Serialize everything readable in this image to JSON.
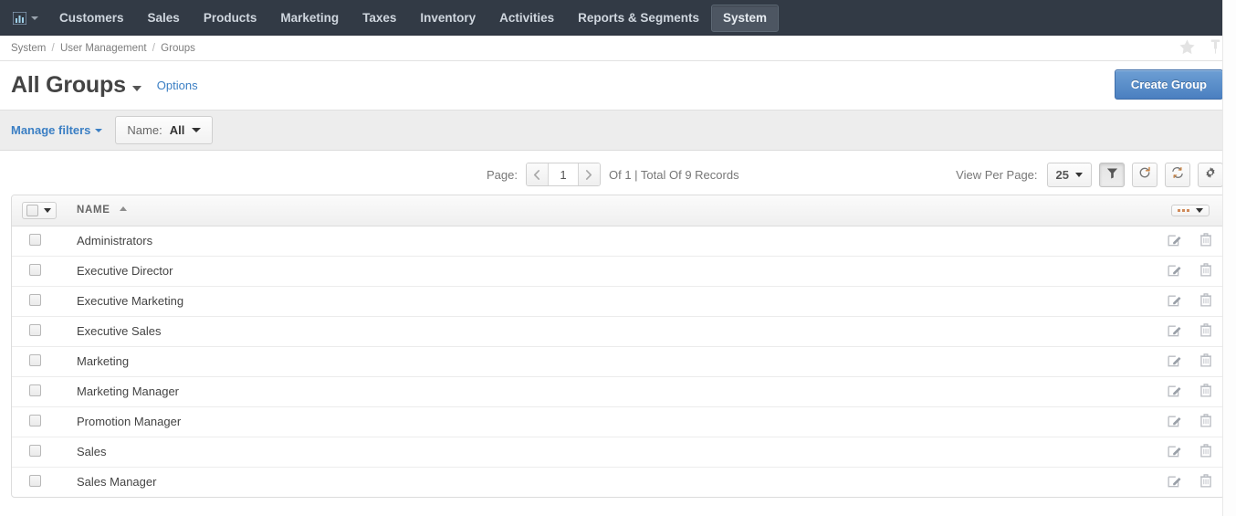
{
  "topnav": {
    "logo_icon": "bar-chart-icon",
    "items": [
      {
        "label": "Customers",
        "active": false
      },
      {
        "label": "Sales",
        "active": false
      },
      {
        "label": "Products",
        "active": false
      },
      {
        "label": "Marketing",
        "active": false
      },
      {
        "label": "Taxes",
        "active": false
      },
      {
        "label": "Inventory",
        "active": false
      },
      {
        "label": "Activities",
        "active": false
      },
      {
        "label": "Reports & Segments",
        "active": false
      },
      {
        "label": "System",
        "active": true
      }
    ]
  },
  "breadcrumb": {
    "items": [
      "System",
      "User Management",
      "Groups"
    ],
    "separator": "/",
    "favorite_icon": "star-icon",
    "pin_icon": "pin-icon"
  },
  "header": {
    "title": "All Groups",
    "options_label": "Options",
    "create_label": "Create Group"
  },
  "filters": {
    "manage_label": "Manage filters",
    "chips": [
      {
        "label": "Name:",
        "value": "All"
      }
    ]
  },
  "toolbar": {
    "page_label": "Page:",
    "page_value": "1",
    "total_label": "Of 1 | Total Of 9 Records",
    "prev_icon": "chevron-left-icon",
    "next_icon": "chevron-right-icon",
    "view_per_page_label": "View Per Page:",
    "view_per_page_value": "25",
    "buttons": [
      {
        "name": "filter-icon",
        "pressed": true
      },
      {
        "name": "reset-icon",
        "pressed": false
      },
      {
        "name": "refresh-icon",
        "pressed": false
      },
      {
        "name": "gear-icon",
        "pressed": false
      }
    ]
  },
  "table": {
    "columns": [
      {
        "key": "check",
        "label": ""
      },
      {
        "key": "name",
        "label": "NAME",
        "sort": "asc"
      },
      {
        "key": "actions",
        "label": ""
      }
    ],
    "rows": [
      {
        "name": "Administrators"
      },
      {
        "name": "Executive Director"
      },
      {
        "name": "Executive Marketing"
      },
      {
        "name": "Executive Sales"
      },
      {
        "name": "Marketing"
      },
      {
        "name": "Marketing Manager"
      },
      {
        "name": "Promotion Manager"
      },
      {
        "name": "Sales"
      },
      {
        "name": "Sales Manager"
      }
    ],
    "row_actions": [
      "edit-icon",
      "delete-icon"
    ]
  },
  "colors": {
    "nav_bg": "#323a45",
    "accent_link": "#3b7fc4",
    "primary_button": "#4a7fc0",
    "filter_bar_bg": "#ededed"
  }
}
